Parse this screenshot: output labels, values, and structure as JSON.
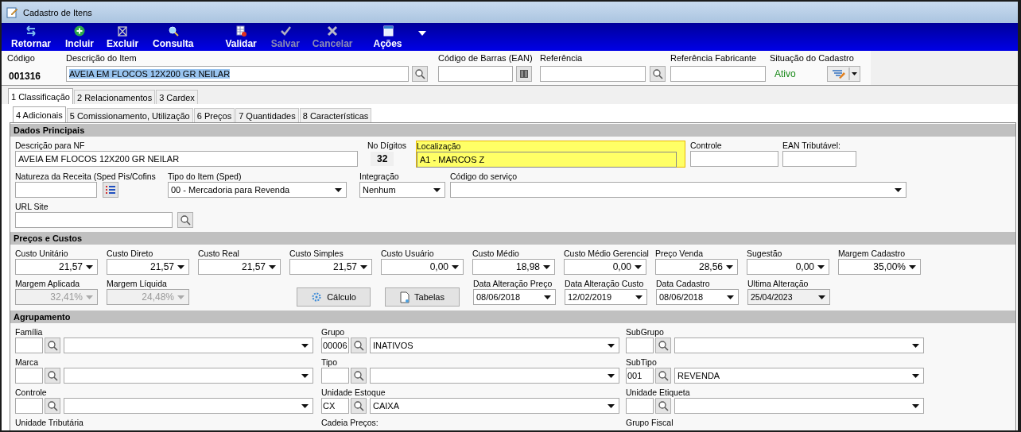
{
  "window": {
    "title": "Cadastro de Itens"
  },
  "toolbar": [
    {
      "label": "Retornar",
      "kind": "return",
      "disabled": false
    },
    {
      "label": "Incluir",
      "kind": "add",
      "disabled": false
    },
    {
      "label": "Excluir",
      "kind": "delete",
      "disabled": false
    },
    {
      "label": "Consulta",
      "kind": "search",
      "disabled": false
    },
    {
      "label": "Validar",
      "kind": "validate",
      "disabled": false
    },
    {
      "label": "Salvar",
      "kind": "save",
      "disabled": true
    },
    {
      "label": "Cancelar",
      "kind": "cancel",
      "disabled": true
    },
    {
      "label": "Ações",
      "kind": "actions",
      "disabled": false
    }
  ],
  "header": {
    "code": {
      "label": "Código",
      "value": "001316"
    },
    "description": {
      "label": "Descrição do Item",
      "value": "AVEIA EM FLOCOS 12X200 GR NEILAR",
      "selected": true
    },
    "barcode": {
      "label": "Código de Barras (EAN)"
    },
    "reference": {
      "label": "Referência"
    },
    "manufacturer_reference": {
      "label": "Referência Fabricante"
    },
    "status": {
      "label": "Situação do Cadastro",
      "value": "Ativo"
    }
  },
  "tabs": [
    {
      "label": "1 Classificação",
      "selected": true
    },
    {
      "label": "2 Relacionamentos",
      "selected": false
    },
    {
      "label": "3 Cardex",
      "selected": false
    }
  ],
  "subtabs": [
    {
      "label": "4 Adicionais",
      "selected": true
    },
    {
      "label": "5 Comissionamento, Utilização",
      "selected": false
    },
    {
      "label": "6 Preços",
      "selected": false
    },
    {
      "label": "7 Quantidades",
      "selected": false
    },
    {
      "label": "8 Características",
      "selected": false
    }
  ],
  "sections": [
    {
      "title": "Dados Principais",
      "lines": [
        {
          "fields": [
            {
              "kind": "text",
              "label": "Descrição para NF",
              "value": "AVEIA EM FLOCOS 12X200 GR NEILAR"
            },
            {
              "kind": "readout",
              "label": "No Dígitos",
              "value": "32"
            },
            {
              "kind": "focused_text",
              "label": "Localização",
              "value": "A1 - MARCOS Z"
            },
            {
              "kind": "text",
              "label": "Controle"
            },
            {
              "kind": "text",
              "label": "EAN Tributável:"
            }
          ]
        },
        {
          "fields": [
            {
              "kind": "list_text",
              "label": "Natureza da Receita (Sped Pis/Cofins"
            },
            {
              "kind": "combo",
              "label": "Tipo do Item (Sped)",
              "value": "00 - Mercadoria para Revenda"
            },
            {
              "kind": "combo",
              "label": "Integração",
              "value": "Nenhum"
            },
            {
              "kind": "combo",
              "label": "Código do serviço"
            }
          ]
        },
        {
          "fields": [
            {
              "kind": "search_text",
              "label": "URL Site"
            }
          ]
        }
      ]
    },
    {
      "title": "Preços e Custos",
      "lines": [
        {
          "fields": [
            {
              "kind": "number_combo",
              "label": "Custo Unitário",
              "value": "21,57",
              "disabled": false
            },
            {
              "kind": "number_combo",
              "label": "Custo Direto",
              "value": "21,57",
              "disabled": false
            },
            {
              "kind": "number_combo",
              "label": "Custo Real",
              "value": "21,57",
              "disabled": false
            },
            {
              "kind": "number_combo",
              "label": "Custo Simples",
              "value": "21,57",
              "disabled": false
            },
            {
              "kind": "number_combo",
              "label": "Custo Usuário",
              "value": "0,00",
              "disabled": false
            },
            {
              "kind": "number_combo",
              "label": "Custo Médio",
              "value": "18,98",
              "disabled": false
            },
            {
              "kind": "number_combo",
              "label": "Custo Médio Gerencial",
              "value": "0,00",
              "disabled": false
            },
            {
              "kind": "number_combo",
              "label": "Preço Venda",
              "value": "28,56",
              "disabled": false
            },
            {
              "kind": "number_combo",
              "label": "Sugestão",
              "value": "0,00",
              "disabled": false
            },
            {
              "kind": "number_combo",
              "label": "Margem Cadastro",
              "value": "35,00%",
              "disabled": false
            }
          ]
        },
        {
          "fields": [
            {
              "kind": "number_combo",
              "label": "Margem Aplicada",
              "value": "32,41%",
              "disabled": true
            },
            {
              "kind": "number_combo",
              "label": "Margem Líquida",
              "value": "24,48%",
              "disabled": true
            },
            {
              "kind": "calc_button",
              "label": "Cálculo"
            },
            {
              "kind": "tables_button",
              "label": "Tabelas"
            },
            {
              "kind": "date_combo",
              "label": "Data Alteração Preço",
              "value": "08/06/2018"
            },
            {
              "kind": "date_combo",
              "label": "Data Alteração Custo",
              "value": "12/02/2019"
            },
            {
              "kind": "date_combo",
              "label": "Data Cadastro",
              "value": "08/06/2018"
            },
            {
              "kind": "readonly_combo",
              "label": "Ultima Alteração",
              "value": "25/04/2023"
            }
          ]
        }
      ]
    },
    {
      "title": "Agrupamento",
      "lines": [
        {
          "fields": [
            {
              "kind": "lookup",
              "label": "Família"
            },
            {
              "kind": "lookup",
              "label": "Grupo",
              "code": "00006",
              "value": "INATIVOS"
            },
            {
              "kind": "lookup",
              "label": "SubGrupo"
            }
          ]
        },
        {
          "fields": [
            {
              "kind": "lookup",
              "label": "Marca"
            },
            {
              "kind": "lookup",
              "label": "Tipo"
            },
            {
              "kind": "lookup",
              "label": "SubTipo",
              "code": "001",
              "value": "REVENDA"
            }
          ]
        },
        {
          "fields": [
            {
              "kind": "lookup",
              "label": "Controle"
            },
            {
              "kind": "lookup",
              "label": "Unidade Estoque",
              "code": "CX",
              "value": "CAIXA"
            },
            {
              "kind": "lookup",
              "label": "Unidade Etiqueta"
            }
          ]
        },
        {
          "fields": [
            {
              "kind": "caption",
              "label": "Unidade Tributária"
            },
            {
              "kind": "caption",
              "label": "Cadeia Preços:"
            },
            {
              "kind": "caption",
              "label": "Grupo Fiscal"
            }
          ]
        }
      ]
    }
  ]
}
